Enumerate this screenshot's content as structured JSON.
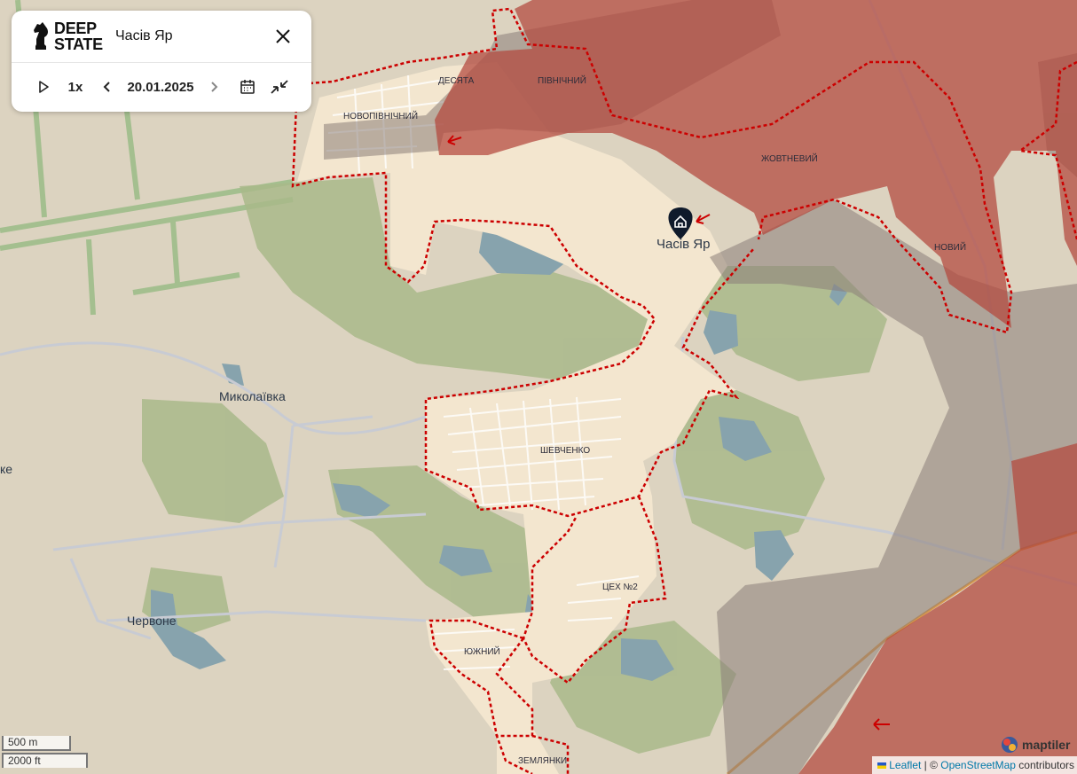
{
  "header": {
    "logo_line1": "DEEP",
    "logo_line2": "STATE",
    "title": "Часів Яр",
    "close_icon": "close-icon"
  },
  "controls": {
    "play_icon": "play-icon",
    "speed": "1x",
    "prev_icon": "chevron-left-icon",
    "date": "20.01.2025",
    "next_icon": "chevron-right-icon",
    "calendar_icon": "calendar-icon",
    "collapse_icon": "collapse-arrows-icon"
  },
  "map": {
    "town_marker": "Часів Яр",
    "marker_icon": "house-icon",
    "arrow_icon": "attack-arrow-icon",
    "districts": {
      "desiata": "ДЕСЯТА",
      "pivnichnyi": "ПІВНІЧНИЙ",
      "novopivnichnyi": "НОВОПІВНІЧНИЙ",
      "zhovtnevyi": "ЖОВТНЕВИЙ",
      "novyi": "НОВИЙ",
      "shevchenko": "ШЕВЧЕНКО",
      "tsekh2": "ЦЕХ №2",
      "yuzhnyi": "ЮЖНИЙ",
      "zemlianky": "ЗЕМЛЯНКИ"
    },
    "towns": {
      "mykolaivka": "Миколаївка",
      "chervone": "Червоне",
      "cut_label": "ке"
    },
    "colors": {
      "occupied": "#b3463c",
      "contested": "#8a7e79",
      "liberated_outline": "#cc0000",
      "urban": "#f3e6cf",
      "forest": "#a9b98a",
      "water": "#87a3ad",
      "base": "#dcd3c0"
    }
  },
  "scale": {
    "metric": "500 m",
    "imperial": "2000 ft"
  },
  "attribution": {
    "leaflet": "Leaflet",
    "separator": " | © ",
    "osm": "OpenStreetMap",
    "contributors": " contributors",
    "maptiler": "maptiler"
  }
}
